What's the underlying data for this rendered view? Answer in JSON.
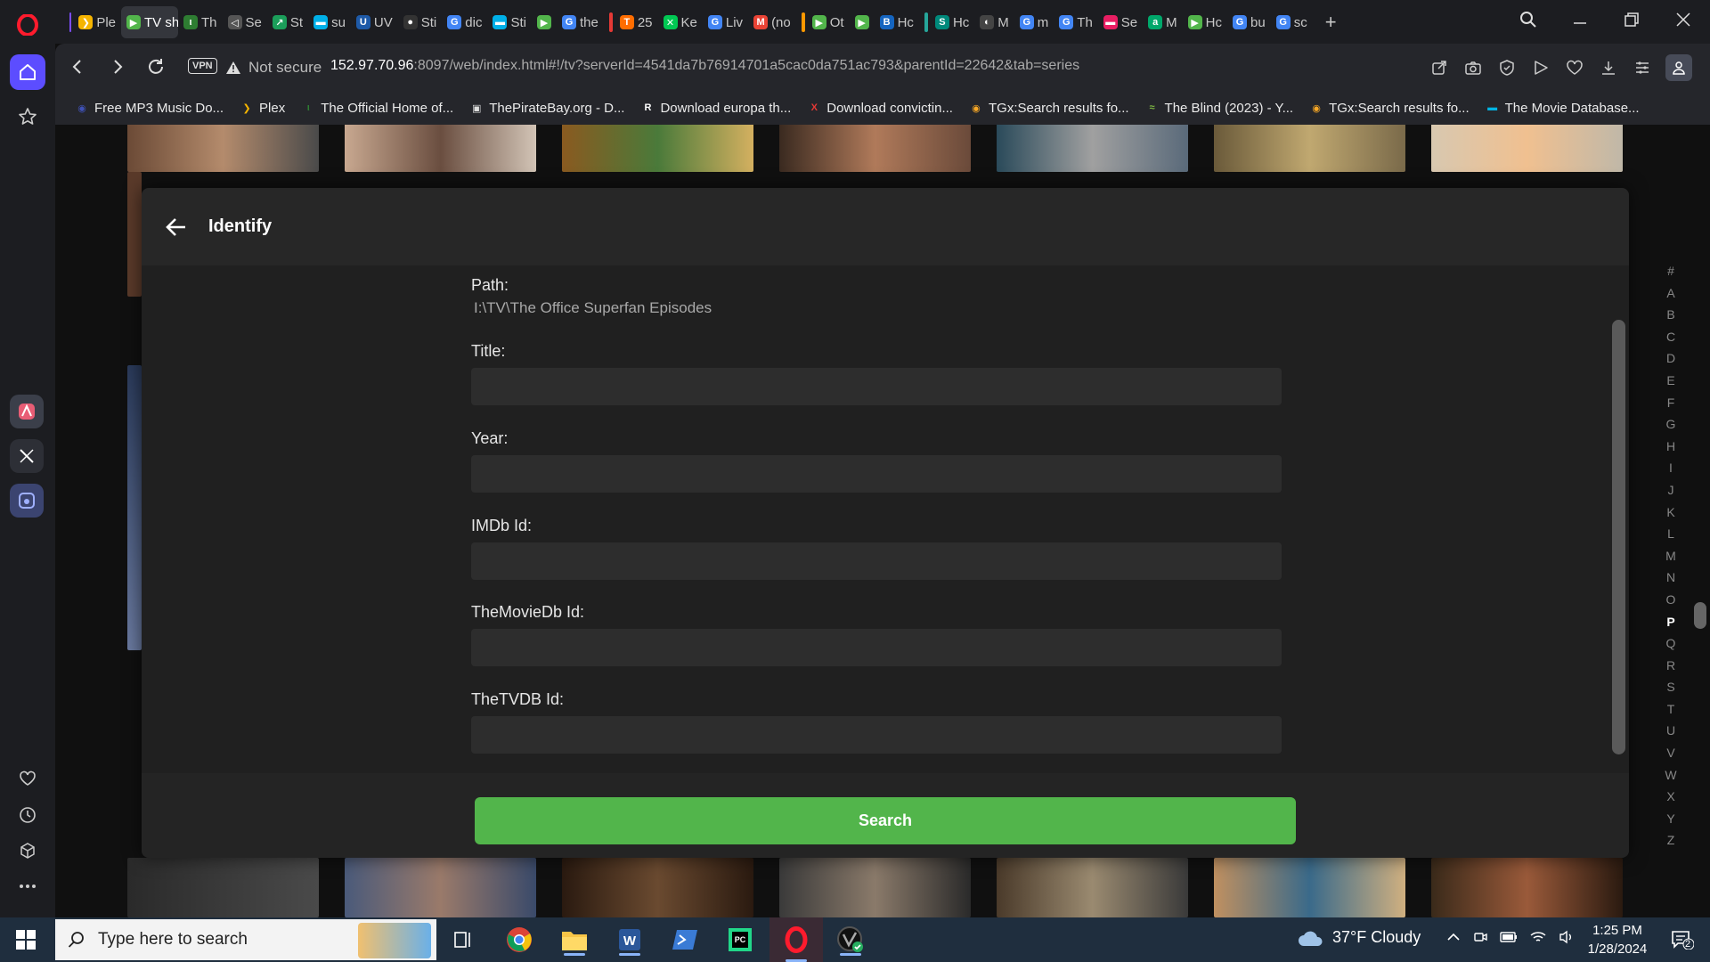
{
  "browser": {
    "tabs": [
      {
        "label": "Ple",
        "color": "#f5b400",
        "icon": "plex-icon",
        "glyph": "❯",
        "pin": "#7c4dff"
      },
      {
        "label": "TV sh",
        "color": "#52b54b",
        "icon": "play-icon",
        "glyph": "▶",
        "active": true
      },
      {
        "label": "Th",
        "color": "#2e7d32",
        "icon": "site-icon",
        "glyph": "ι"
      },
      {
        "label": "Se",
        "color": "#555",
        "icon": "mute-icon",
        "glyph": "◁"
      },
      {
        "label": "St",
        "color": "#1b9e5a",
        "icon": "site-icon",
        "glyph": "↗"
      },
      {
        "label": "su",
        "color": "#00b0e8",
        "icon": "dash-icon",
        "glyph": "▬"
      },
      {
        "label": "UV",
        "color": "#1e5aa8",
        "icon": "site-icon",
        "glyph": "U"
      },
      {
        "label": "Sti",
        "color": "#333",
        "icon": "github-icon",
        "glyph": "●"
      },
      {
        "label": "dic",
        "color": "#4285f4",
        "icon": "google-icon",
        "glyph": "G"
      },
      {
        "label": "Sti",
        "color": "#00b0e8",
        "icon": "dash-icon",
        "glyph": "▬"
      },
      {
        "label": "",
        "color": "#52b54b",
        "icon": "play-pause-icon",
        "glyph": "▶"
      },
      {
        "label": "the",
        "color": "#4285f4",
        "icon": "google-icon",
        "glyph": "G"
      },
      {
        "label": "25",
        "color": "#ff6d00",
        "icon": "t-icon",
        "glyph": "T",
        "pin": "#e53935"
      },
      {
        "label": "Ke",
        "color": "#00c853",
        "icon": "site-icon",
        "glyph": "✕"
      },
      {
        "label": "Liv",
        "color": "#4285f4",
        "icon": "google-icon",
        "glyph": "G"
      },
      {
        "label": "(no",
        "color": "#ea4335",
        "icon": "gmail-icon",
        "glyph": "M"
      },
      {
        "label": "Ot",
        "color": "#52b54b",
        "icon": "play-icon",
        "glyph": "▶",
        "pin": "#ff9800"
      },
      {
        "label": "",
        "color": "#52b54b",
        "icon": "play-pause-icon",
        "glyph": "▶"
      },
      {
        "label": "Hc",
        "color": "#1565c0",
        "icon": "site-icon",
        "glyph": "B"
      },
      {
        "label": "Hc",
        "color": "#00897b",
        "icon": "site-icon",
        "glyph": "S",
        "pin": "#26a69a"
      },
      {
        "label": "M",
        "color": "#444",
        "icon": "site-icon",
        "glyph": "◐"
      },
      {
        "label": "m",
        "color": "#4285f4",
        "icon": "google-icon",
        "glyph": "G"
      },
      {
        "label": "Th",
        "color": "#4285f4",
        "icon": "google-icon",
        "glyph": "G"
      },
      {
        "label": "Se",
        "color": "#e91e63",
        "icon": "site-icon",
        "glyph": "▬"
      },
      {
        "label": "M",
        "color": "#00a86b",
        "icon": "site-icon",
        "glyph": "a"
      },
      {
        "label": "Hc",
        "color": "#52b54b",
        "icon": "play-icon",
        "glyph": "▶"
      },
      {
        "label": "bu",
        "color": "#4285f4",
        "icon": "google-icon",
        "glyph": "G"
      },
      {
        "label": "sc",
        "color": "#4285f4",
        "icon": "google-icon",
        "glyph": "G"
      }
    ],
    "new_tab": "+",
    "address": {
      "vpn": "VPN",
      "not_secure": "Not secure",
      "host": "152.97.70.96",
      "rest": ":8097/web/index.html#!/tv?serverId=4541da7b76914701a5cac0da751ac793&parentId=22642&tab=series"
    },
    "bookmarks": [
      {
        "label": "Free MP3 Music Do...",
        "icon": "music-icon",
        "color": "#3f51b5",
        "glyph": "◉"
      },
      {
        "label": "Plex",
        "icon": "plex-icon",
        "color": "#f5b400",
        "glyph": "❯"
      },
      {
        "label": "The Official Home of...",
        "icon": "site-icon",
        "color": "#2e7d32",
        "glyph": "ι"
      },
      {
        "label": "ThePirateBay.org - D...",
        "icon": "pirate-icon",
        "color": "#ddd",
        "glyph": "▣"
      },
      {
        "label": "Download europa th...",
        "icon": "r-icon",
        "color": "#fff",
        "glyph": "R"
      },
      {
        "label": "Download convictin...",
        "icon": "x-icon",
        "color": "#e53935",
        "glyph": "X"
      },
      {
        "label": "TGx:Search results fo...",
        "icon": "tgx-icon",
        "color": "#f9a825",
        "glyph": "◉"
      },
      {
        "label": "The Blind (2023) - Y...",
        "icon": "yts-icon",
        "color": "#7cb342",
        "glyph": "≈"
      },
      {
        "label": "TGx:Search results fo...",
        "icon": "tgx-icon",
        "color": "#f9a825",
        "glyph": "◉"
      },
      {
        "label": "The Movie Database...",
        "icon": "tmdb-icon",
        "color": "#01b4e4",
        "glyph": "▬"
      }
    ]
  },
  "alphabet": [
    "#",
    "A",
    "B",
    "C",
    "D",
    "E",
    "F",
    "G",
    "H",
    "I",
    "J",
    "K",
    "L",
    "M",
    "N",
    "O",
    "P",
    "Q",
    "R",
    "S",
    "T",
    "U",
    "V",
    "W",
    "X",
    "Y",
    "Z"
  ],
  "alphabet_active": "P",
  "dialog": {
    "title": "Identify",
    "path_label": "Path:",
    "path_value": "I:\\TV\\The Office Superfan Episodes",
    "fields": [
      {
        "label": "Title:",
        "value": ""
      },
      {
        "label": "Year:",
        "value": ""
      },
      {
        "label": "IMDb Id:",
        "value": ""
      },
      {
        "label": "TheMovieDb Id:",
        "value": ""
      },
      {
        "label": "TheTVDB Id:",
        "value": ""
      }
    ],
    "search_button": "Search"
  },
  "taskbar": {
    "search_placeholder": "Type here to search",
    "weather": "37°F  Cloudy",
    "time": "1:25 PM",
    "date": "1/28/2024",
    "notifications": "2"
  },
  "colors": {
    "accent_green": "#52b54b",
    "opera_red": "#ff1b2d",
    "home_blue": "#5c4dff"
  }
}
